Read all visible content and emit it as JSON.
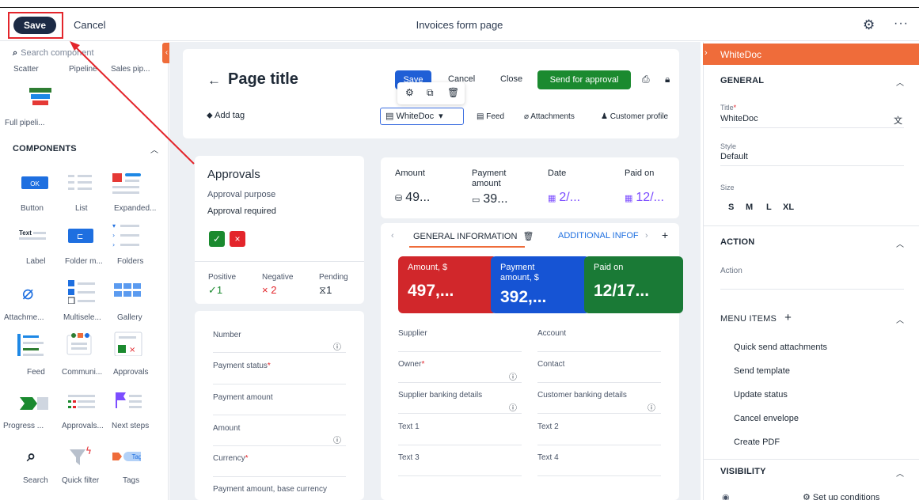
{
  "topbar": {
    "save_label": "Save",
    "cancel_label": "Cancel",
    "page_name": "Invoices form page",
    "more_label": "···"
  },
  "palette": {
    "search_placeholder": "Search component",
    "charts": [
      "Scatter",
      "Pipeline",
      "Sales pip...",
      "Full pipeli..."
    ],
    "section_title": "COMPONENTS",
    "components": [
      "Button",
      "List",
      "Expanded...",
      "Label",
      "Folder m...",
      "Folders",
      "Attachme...",
      "Multisele...",
      "Gallery",
      "Feed",
      "Communi...",
      "Approvals",
      "Progress ...",
      "Approvals...",
      "Next steps",
      "Search",
      "Quick filter",
      "Tags"
    ],
    "icon_text": {
      "button": "OK",
      "label": "Text",
      "tag": "Tag"
    }
  },
  "header_card": {
    "title": "Page title",
    "add_tag": "Add tag",
    "save": "Save",
    "cancel": "Cancel",
    "close": "Close",
    "send_for_approval": "Send for approval",
    "whitedoc_select": "WhiteDoc",
    "tabs": [
      "Feed",
      "Attachments",
      "Customer profile"
    ]
  },
  "approvals": {
    "title": "Approvals",
    "purpose": "Approval purpose",
    "required": "Approval required",
    "stats": [
      {
        "label": "Positive",
        "value": "✓1",
        "color": "#1b8a2f"
      },
      {
        "label": "Negative",
        "value": "× 2",
        "color": "#e3252b"
      },
      {
        "label": "Pending",
        "value": "⧖1",
        "color": "#1f2a37"
      }
    ]
  },
  "summary": {
    "items": [
      {
        "label": "Amount",
        "value": "49..."
      },
      {
        "label": "Payment amount",
        "value": "39..."
      },
      {
        "label": "Date",
        "value": "2/..."
      },
      {
        "label": "Paid on",
        "value": "12/..."
      }
    ]
  },
  "detail_tabs": {
    "general": "GENERAL INFORMATION",
    "additional": "ADDITIONAL INFOF",
    "tiles": [
      {
        "label": "Amount, $",
        "value": "497,...",
        "color": "#d1272b"
      },
      {
        "label": "Payment amount, $",
        "value": "392,...",
        "color": "#1654d4"
      },
      {
        "label": "Paid on",
        "value": "12/17...",
        "color": "#1a7a36"
      }
    ],
    "fields_left": [
      "Supplier",
      "Owner",
      "Supplier banking details",
      "Text 1",
      "Text 3"
    ],
    "fields_right": [
      "Account",
      "Contact",
      "Customer banking details",
      "Text 2",
      "Text 4"
    ]
  },
  "left_form": {
    "fields": [
      "Number",
      "Payment status",
      "Payment amount",
      "Amount",
      "Currency",
      "Payment amount, base currency"
    ]
  },
  "right_panel": {
    "header": "WhiteDoc",
    "general": "GENERAL",
    "title_label": "Title",
    "title_value": "WhiteDoc",
    "style_label": "Style",
    "style_value": "Default",
    "size_label": "Size",
    "sizes": [
      "S",
      "M",
      "L",
      "XL"
    ],
    "action_section": "ACTION",
    "action_label": "Action",
    "menu_section": "MENU ITEMS",
    "menu_items": [
      "Quick send attachments",
      "Send template",
      "Update status",
      "Cancel envelope",
      "Create PDF"
    ],
    "visibility_section": "VISIBILITY",
    "conditions": "Set up conditions"
  },
  "colors": {
    "accent_orange": "#ef6c3a",
    "primary_blue": "#1f5fd6",
    "approve_green": "#1b8a2f",
    "highlight_red": "#e3252b"
  }
}
